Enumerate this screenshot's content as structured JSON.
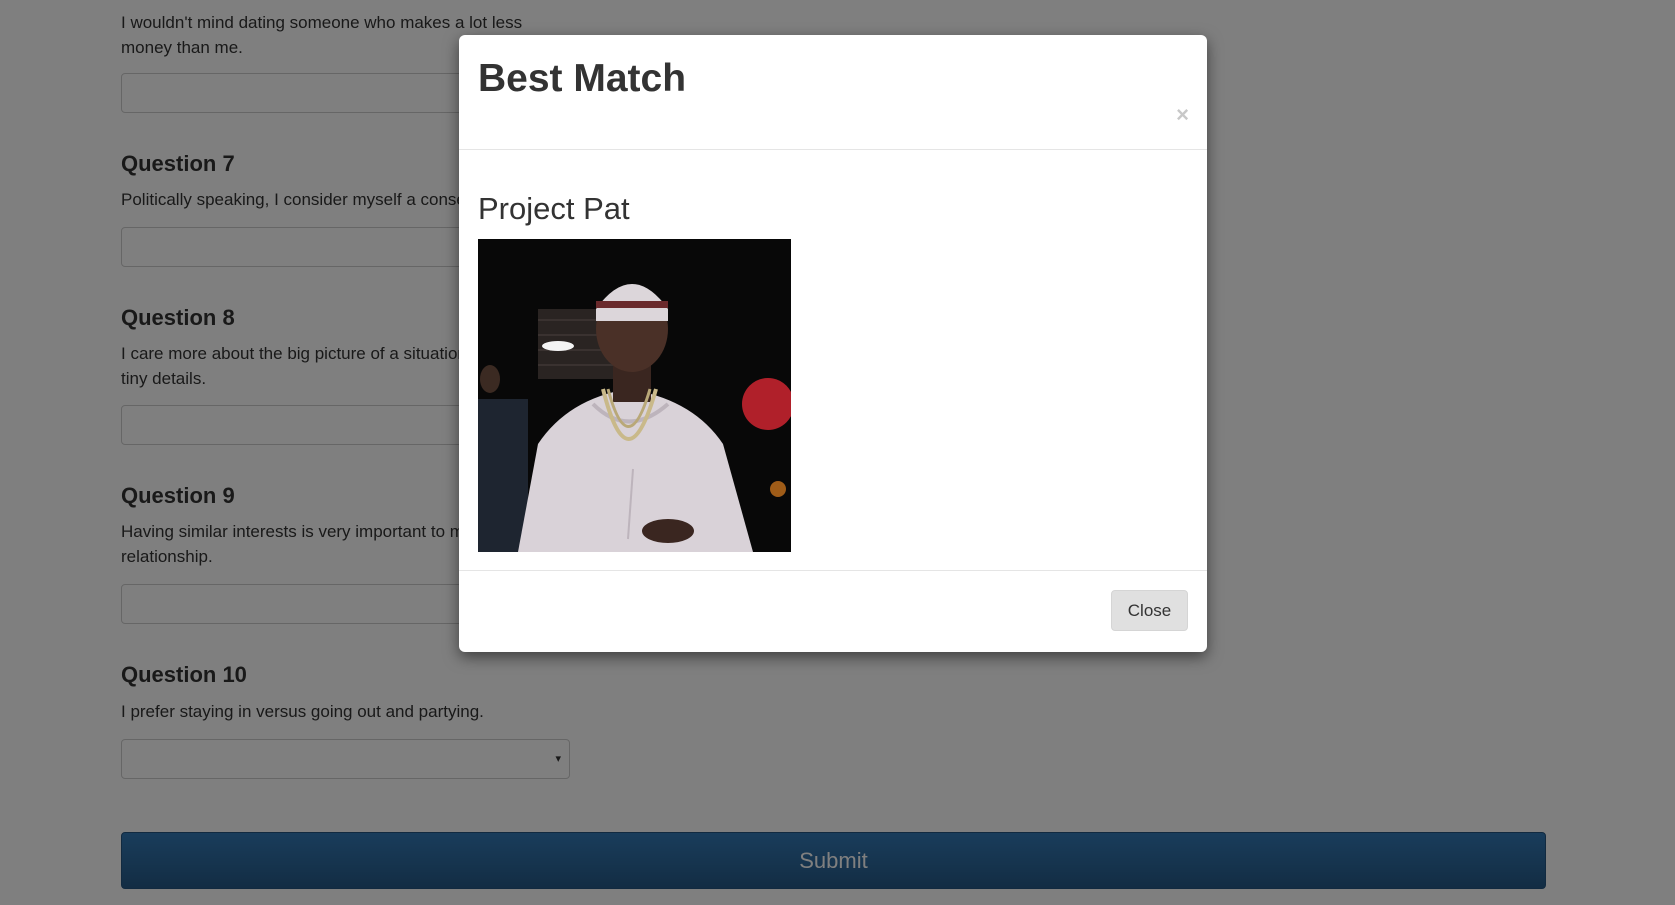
{
  "form": {
    "q6": {
      "text": "I wouldn't mind dating someone who makes a lot less money than me."
    },
    "q7": {
      "title": "Question 7",
      "text": "Politically speaking, I consider myself a conservative."
    },
    "q8": {
      "title": "Question 8",
      "text": "I care more about the big picture of a situation than the tiny details."
    },
    "q9": {
      "title": "Question 9",
      "text": "Having similar interests is very important to me in a relationship."
    },
    "q10": {
      "title": "Question 10",
      "text": "I prefer staying in versus going out and partying.",
      "selected_value": "",
      "arrow": "▾"
    },
    "submit_label": "Submit"
  },
  "modal": {
    "title": "Best Match",
    "close_x": "×",
    "match_name": "Project Pat",
    "close_label": "Close"
  }
}
